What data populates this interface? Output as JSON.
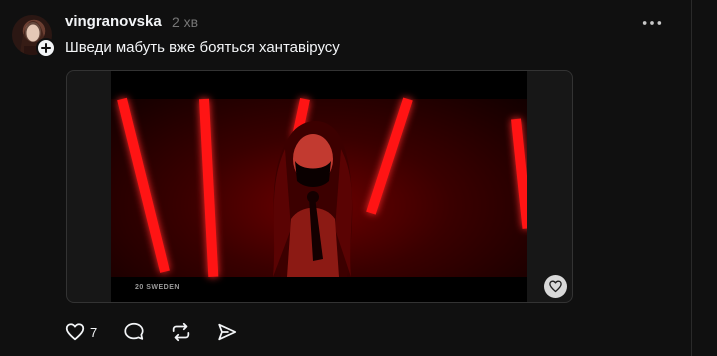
{
  "post": {
    "username": "vingranovska",
    "time": "2 хв",
    "caption": "Шведи мабуть вже бояться хантавірусу",
    "video_label": "20 SWEDEN",
    "like_count": "7"
  },
  "icons": {
    "add": "plus-icon",
    "more": "more-icon",
    "like": "heart-icon",
    "comment": "comment-icon",
    "repost": "repost-icon",
    "share": "share-icon"
  },
  "colors": {
    "background": "#101010",
    "text": "#f3f5f7",
    "muted": "#777777",
    "stage_red": "#ff1414"
  }
}
